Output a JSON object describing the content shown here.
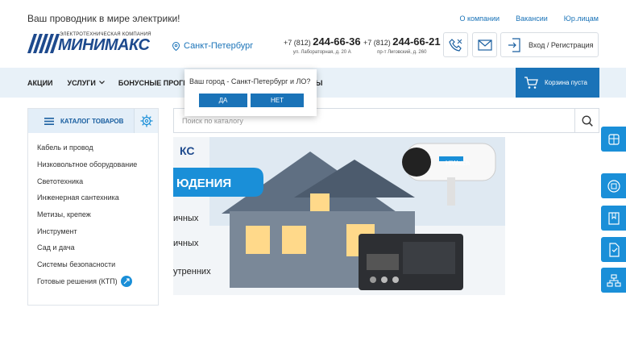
{
  "header": {
    "tagline": "Ваш проводник в мире электрики!",
    "top_links": [
      "О компании",
      "Вакансии",
      "Юр.лицам"
    ],
    "logo_subtitle": "ЭЛЕКТРОТЕХНИЧЕСКАЯ КОМПАНИЯ",
    "logo_text": "МИНИМАКС",
    "city": "Санкт-Петербург",
    "phones": [
      {
        "prefix": "+7 (812) ",
        "number": "244-66-36",
        "address": "ул. Лабораторная, д. 20 А"
      },
      {
        "prefix": "+7 (812) ",
        "number": "244-66-21",
        "address": "пр-т Лиговский, д. 260"
      }
    ],
    "login_label": "Вход / Регистрация"
  },
  "nav": {
    "items": [
      "АКЦИИ",
      "УСЛУГИ",
      "БОНУСНЫЕ ПРОГРАММ",
      "АКТЫ"
    ],
    "cart_label": "Корзина пуста"
  },
  "city_popup": {
    "question": "Ваш город - Санкт-Петербург и ЛО?",
    "yes": "ДА",
    "no": "НЕТ"
  },
  "catalog": {
    "title": "КАТАЛОГ ТОВАРОВ",
    "items": [
      "Кабель и провод",
      "Низковольтное оборудование",
      "Светотехника",
      "Инженерная сантехника",
      "Метизы, крепеж",
      "Инструмент",
      "Сад и дача",
      "Системы безопасности",
      "Готовые решения (КТП)"
    ]
  },
  "search": {
    "placeholder": "Поиск по каталогу"
  },
  "banner": {
    "logo_fragment": "КС",
    "heading_fragment": "ЮДЕНИЯ",
    "lines": [
      "ичных",
      "ичных",
      "утренних"
    ],
    "camera_brand": "HiWatch",
    "dots": 3
  },
  "colors": {
    "brand": "#1a73b8",
    "nav_bg": "#e8f1f8",
    "side_tab": "#1a8fd8"
  }
}
